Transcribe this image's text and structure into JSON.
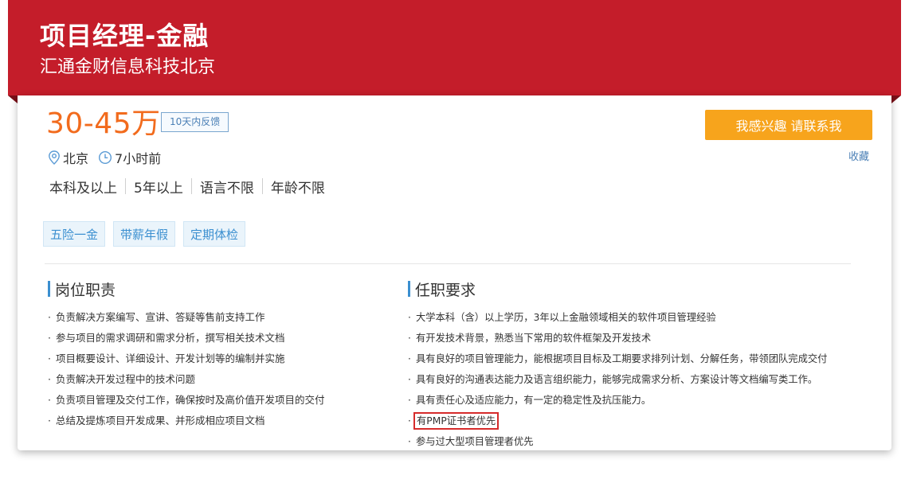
{
  "header": {
    "job_title": "项目经理-金融",
    "company": "汇通金财信息科技北京"
  },
  "job": {
    "salary": "30-45万",
    "feedback_badge": "10天内反馈",
    "location": "北京",
    "posted": "7小时前",
    "requirements": [
      "本科及以上",
      "5年以上",
      "语言不限",
      "年龄不限"
    ],
    "benefits": [
      "五险一金",
      "带薪年假",
      "定期体检"
    ]
  },
  "actions": {
    "interest_button": "我感兴趣 请联系我",
    "favorite": "收藏"
  },
  "responsibilities": {
    "title": "岗位职责",
    "items": [
      "负责解决方案编写、宣讲、答疑等售前支持工作",
      "参与项目的需求调研和需求分析，撰写相关技术文档",
      "项目概要设计、详细设计、开发计划等的编制并实施",
      "负责解决开发过程中的技术问题",
      "负责项目管理及交付工作，确保按时及高价值开发项目的交付",
      "总结及提炼项目开发成果、并形成相应项目文档"
    ]
  },
  "qualifications": {
    "title": "任职要求",
    "items": [
      "大学本科（含）以上学历，3年以上金融领域相关的软件项目管理经验",
      "有开发技术背景，熟悉当下常用的软件框架及开发技术",
      "具有良好的项目管理能力，能根据项目目标及工期要求排列计划、分解任务，带领团队完成交付",
      "具有良好的沟通表达能力及语言组织能力，能够完成需求分析、方案设计等文档编写类工作。",
      "具有责任心及适应能力，有一定的稳定性及抗压能力。",
      "有PMP证书者优先",
      "参与过大型项目管理者优先"
    ]
  },
  "colors": {
    "header_bg": "#c41d2a",
    "salary": "#f26b1d",
    "accent_blue": "#3b8fd0",
    "button_bg": "#f7a41c",
    "highlight_box": "#d62b2b"
  }
}
